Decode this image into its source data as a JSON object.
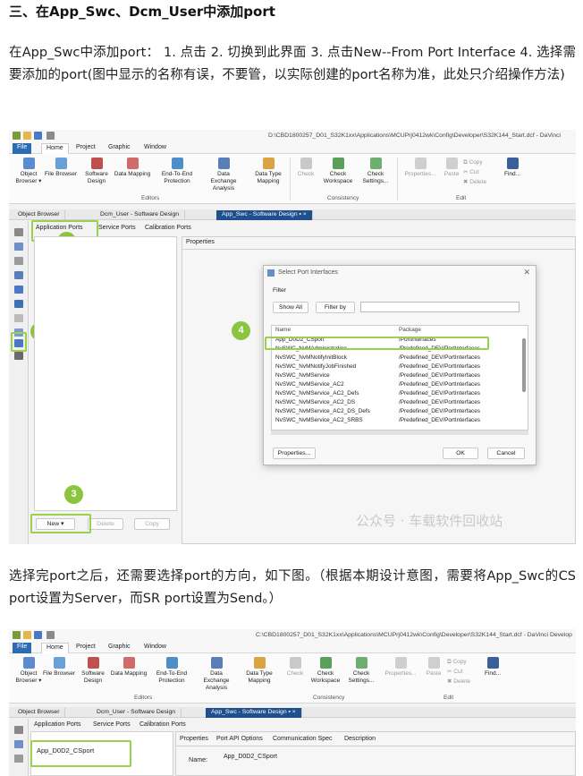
{
  "section_title": "三、在App_Swc、Dcm_User中添加port",
  "paragraph1": "在App_Swc中添加port： 1. 点击 2. 切换到此界面 3. 点击New--From Port Interface 4. 选择需要添加的port(图中显示的名称有误，不要管，以实际创建的port名称为准，此处只介绍操作方法)",
  "paragraph2": "选择完port之后，还需要选择port的方向，如下图。（根据本期设计意图，需要将App_Swc的CS port设置为Server，而SR port设置为Send。）",
  "screenshot1": {
    "window_path": "D:\\CBD1800257_D01_S32K1xx\\Applications\\MCUPrj0412wk\\Config\\Developer\\S32K144_Start.dcf - DaVinci",
    "menu_tabs": [
      "File",
      "Home",
      "Project",
      "Graphic",
      "Window"
    ],
    "ribbon": {
      "buttons": [
        {
          "label": "Object Browser ▾"
        },
        {
          "label": "File Browser"
        },
        {
          "label": "Software Design"
        },
        {
          "label": "Data Mapping"
        },
        {
          "label": "End-To-End Protection"
        },
        {
          "label": "Data Exchange Analysis"
        },
        {
          "label": "Data Type Mapping"
        },
        {
          "label": "Check"
        },
        {
          "label": "Check Workspace"
        },
        {
          "label": "Check Settings..."
        },
        {
          "label": "Properties..."
        },
        {
          "label": "Paste"
        },
        {
          "label": "Copy"
        },
        {
          "label": "Cut"
        },
        {
          "label": "Delete"
        },
        {
          "label": "Find..."
        }
      ],
      "groups": [
        "Editors",
        "Consistency",
        "Edit"
      ]
    },
    "doc_tabs": [
      "Object Browser",
      "Dcm_User - Software Design",
      "App_Swc - Software Design  ▪ ×"
    ],
    "sub_tabs": [
      "Application Ports",
      "Service Ports",
      "Calibration Ports"
    ],
    "properties_tab": "Properties",
    "bottom_buttons": [
      "New ▾",
      "Delete",
      "Copy"
    ],
    "badges": [
      "1",
      "2",
      "3",
      "4"
    ],
    "dialog": {
      "title": "Select Port Interfaces",
      "filter_label": "Filter",
      "show_all": "Show All",
      "filter_by": "Filter by",
      "col_name": "Name",
      "col_package": "Package",
      "rows": [
        {
          "name": "App_D0D2_CSport",
          "package": "/PortInterfaces"
        },
        {
          "name": "NvSWC_NvMAdministration",
          "package": "/Predefined_DEV/PortInterfaces"
        },
        {
          "name": "NvSWC_NvMNotifyInitBlock",
          "package": "/Predefined_DEV/PortInterfaces"
        },
        {
          "name": "NvSWC_NvMNotifyJobFinished",
          "package": "/Predefined_DEV/PortInterfaces"
        },
        {
          "name": "NvSWC_NvMService",
          "package": "/Predefined_DEV/PortInterfaces"
        },
        {
          "name": "NvSWC_NvMService_AC2",
          "package": "/Predefined_DEV/PortInterfaces"
        },
        {
          "name": "NvSWC_NvMService_AC2_Defs",
          "package": "/Predefined_DEV/PortInterfaces"
        },
        {
          "name": "NvSWC_NvMService_AC2_DS",
          "package": "/Predefined_DEV/PortInterfaces"
        },
        {
          "name": "NvSWC_NvMService_AC2_DS_Defs",
          "package": "/Predefined_DEV/PortInterfaces"
        },
        {
          "name": "NvSWC_NvMService_AC2_SRBS",
          "package": "/Predefined_DEV/PortInterfaces"
        }
      ],
      "properties_btn": "Properties...",
      "ok": "OK",
      "cancel": "Cancel"
    },
    "watermark": "公众号 · 车载软件回收站"
  },
  "screenshot2": {
    "window_path": "C:\\CBD1800257_D01_S32K1xx\\Applications\\MCUPrj0412wk\\Config\\Developer\\S32K144_Start.dcf - DaVinci Develop",
    "prop_tabs": [
      "Properties",
      "Port API Options",
      "Communication Spec",
      "Description"
    ],
    "port_item": "App_D0D2_CSport",
    "name_label": "Name:",
    "name_value": "App_D0D2_CSport"
  },
  "colors": {
    "highlight": "#9ad14b",
    "badge": "#8bc53f",
    "file_tab": "#2b6cb5",
    "active_doc_tab": "#1f4f8f"
  }
}
